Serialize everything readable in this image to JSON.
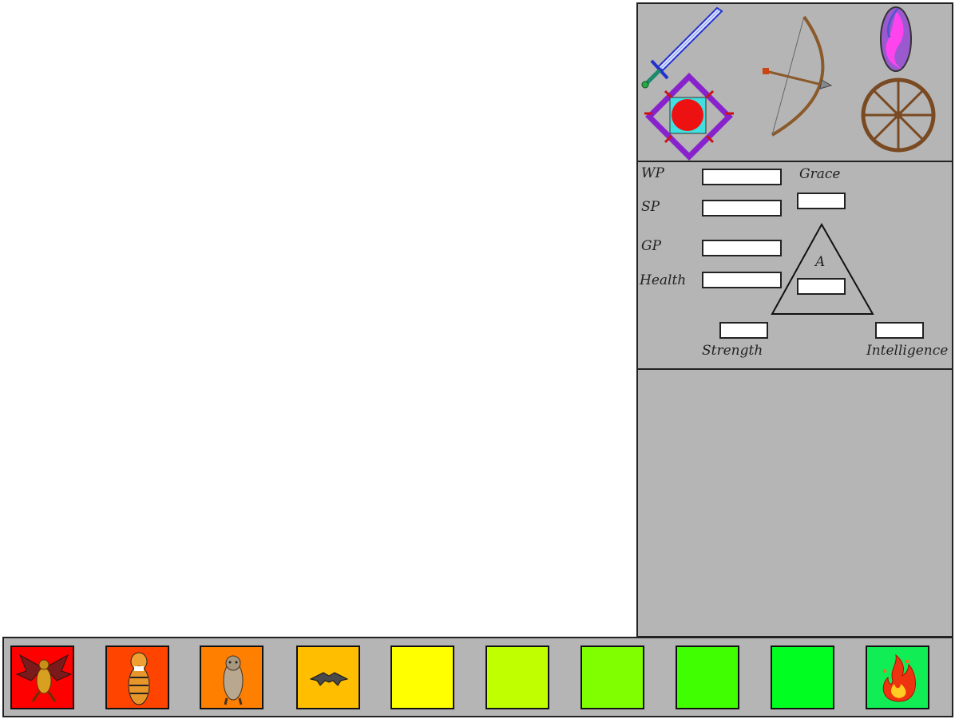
{
  "equipment": {
    "items": [
      "sword-icon",
      "bow-icon",
      "gem-icon",
      "amulet-icon",
      "wheel-icon"
    ]
  },
  "stats": {
    "wp_label": "WP",
    "sp_label": "SP",
    "gp_label": "GP",
    "health_label": "Health",
    "grace_label": "Grace",
    "triangle_label": "A",
    "strength_label": "Strength",
    "intelligence_label": "Intelligence"
  },
  "creature_bar": {
    "slots": [
      {
        "color": "#ff0000",
        "icon": "dragon-icon"
      },
      {
        "color": "#ff4400",
        "icon": "tiger-icon"
      },
      {
        "color": "#ff7f00",
        "icon": "boar-icon"
      },
      {
        "color": "#ffbf00",
        "icon": "bat-icon"
      },
      {
        "color": "#ffff00",
        "icon": null
      },
      {
        "color": "#bfff00",
        "icon": null
      },
      {
        "color": "#80ff00",
        "icon": null
      },
      {
        "color": "#40ff00",
        "icon": null
      },
      {
        "color": "#00ff20",
        "icon": null
      },
      {
        "color": "#11ee55",
        "icon": "fire-elemental-icon"
      }
    ]
  }
}
